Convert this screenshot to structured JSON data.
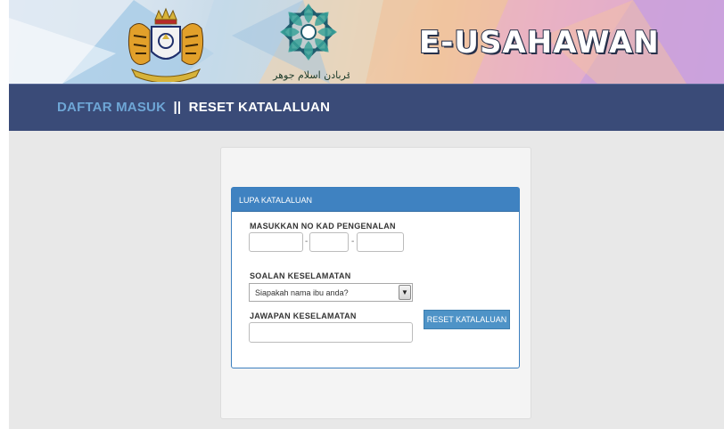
{
  "banner": {
    "app_title": "E-USAHAWAN",
    "emblem_caption": "قربادن اسلام جوهر"
  },
  "nav": {
    "breadcrumb_login": "DAFTAR MASUK",
    "separator": "||",
    "breadcrumb_reset": "RESET KATALALUAN"
  },
  "panel": {
    "title": "LUPA KATALALUAN",
    "ic_label": "MASUKKAN NO KAD PENGENALAN",
    "ic_dash": "-",
    "ic_part1": "",
    "ic_part2": "",
    "ic_part3": "",
    "security_question_label": "SOALAN KESELAMATAN",
    "security_question_selected": "Siapakah nama ibu anda?",
    "security_answer_label": "JAWAPAN KESELAMATAN",
    "security_answer_value": "",
    "reset_button": "RESET KATALALUAN"
  },
  "colors": {
    "navbar": "#3a4b78",
    "breadcrumb_active": "#6ea6d6",
    "panel_header": "#3f82c1",
    "button": "#4e93c7"
  }
}
